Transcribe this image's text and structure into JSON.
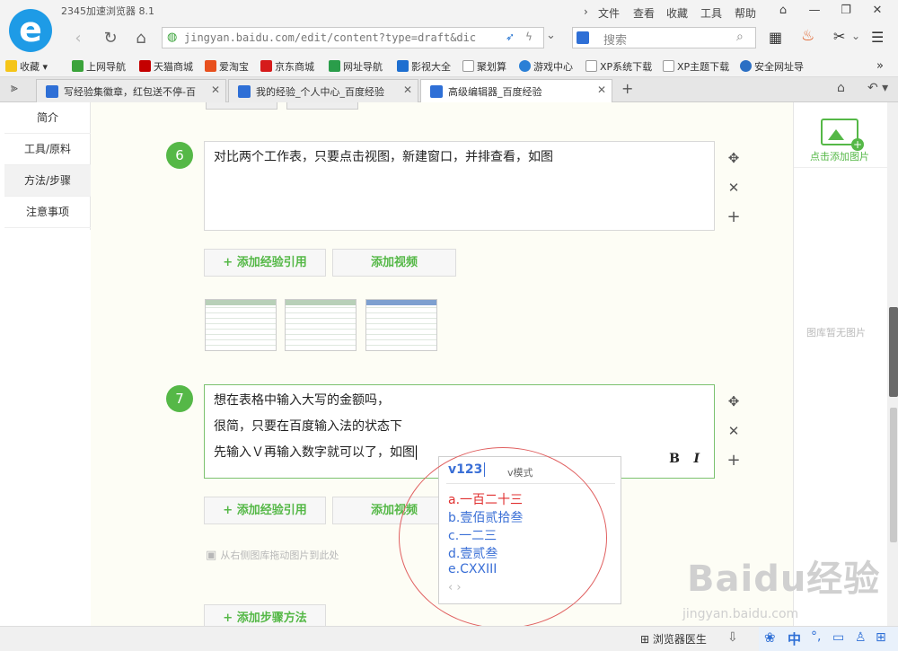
{
  "browser": {
    "app_title": "2345加速浏览器 8.1",
    "menu": [
      "文件",
      "查看",
      "收藏",
      "工具",
      "帮助"
    ],
    "address": "jingyan.baidu.com/edit/content?type=draft&dic",
    "search_placeholder": "搜索"
  },
  "bookmarks": [
    {
      "label": "收藏",
      "color": "#f5c518"
    },
    {
      "label": "上网导航",
      "color": "#3aa33a"
    },
    {
      "label": "天猫商城",
      "color": "#c40000"
    },
    {
      "label": "爱淘宝",
      "color": "#e8501e"
    },
    {
      "label": "京东商城",
      "color": "#d61b1b"
    },
    {
      "label": "网址导航",
      "color": "#2a9d4a"
    },
    {
      "label": "影视大全",
      "color": "#1e6fd0"
    },
    {
      "label": "聚划算",
      "color": "#e34b6a"
    },
    {
      "label": "游戏中心",
      "color": "#2a7fd6"
    },
    {
      "label": "XP系统下载",
      "color": "#999999"
    },
    {
      "label": "XP主题下载",
      "color": "#999999"
    },
    {
      "label": "安全网址导",
      "color": "#2b6fc4"
    }
  ],
  "tabs": [
    {
      "label": "写经验集徽章，红包送不停-百"
    },
    {
      "label": "我的经验_个人中心_百度经验"
    },
    {
      "label": "高级编辑器_百度经验"
    }
  ],
  "left_nav": [
    "简介",
    "工具/原料",
    "方法/步骤",
    "注意事项"
  ],
  "steps": [
    {
      "number": "6",
      "text": "对比两个工作表，只要点击视图，新建窗口，并排查看，如图"
    },
    {
      "number": "7",
      "lines": [
        "想在表格中输入大写的金额吗，",
        "很简，只要在百度输入法的状态下",
        "先输入Ｖ再输入数字就可以了，如图"
      ]
    }
  ],
  "buttons": {
    "add_ref": "+ 添加经验引用",
    "add_video": "添加视频",
    "add_step": "+ 添加步骤方法",
    "bold": "B",
    "italic": "I"
  },
  "drag_hint": "从右侧图库拖动图片到此处",
  "right_panel": {
    "add_image": "点击添加图片",
    "empty": "图库暂无图片"
  },
  "ime": {
    "input": "v123",
    "mode": "v模式",
    "candidates": [
      "a.一百二十三",
      "b.壹佰贰拾叁",
      "c.一二三",
      "d.壹贰叁",
      "e.CXXIII"
    ]
  },
  "status": {
    "doctor": "浏览器医生",
    "ime_label": "中"
  },
  "watermark": {
    "brand": "Baidu经验",
    "url": "jingyan.baidu.com"
  }
}
